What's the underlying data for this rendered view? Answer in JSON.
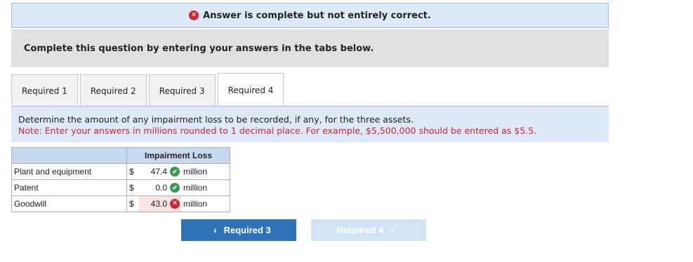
{
  "banner": {
    "text": "Answer is complete but not entirely correct."
  },
  "instruction": {
    "text": "Complete this question by entering your answers in the tabs below."
  },
  "tabs": [
    {
      "label": "Required 1"
    },
    {
      "label": "Required 2"
    },
    {
      "label": "Required 3"
    },
    {
      "label": "Required 4"
    }
  ],
  "question": {
    "prompt": "Determine the amount of any impairment loss to be recorded, if any, for the three assets.",
    "note": "Note: Enter your answers in millions rounded to 1 decimal place. For example, $5,500,000 should be entered as $5.5."
  },
  "table": {
    "header": "Impairment Loss",
    "rows": [
      {
        "label": "Plant and equipment",
        "currency": "$",
        "value": "47.4",
        "unit": "million",
        "status": "correct"
      },
      {
        "label": "Patent",
        "currency": "$",
        "value": "0.0",
        "unit": "million",
        "status": "correct"
      },
      {
        "label": "Goodwill",
        "currency": "$",
        "value": "43.0",
        "unit": "million",
        "status": "incorrect"
      }
    ]
  },
  "nav": {
    "prev_label": "Required 3",
    "next_label": "Required 4"
  },
  "colors": {
    "correct": "#3a9a52",
    "incorrect": "#d0242f",
    "primary_button": "#2e72b8",
    "disabled_button": "#d4e3f3"
  }
}
